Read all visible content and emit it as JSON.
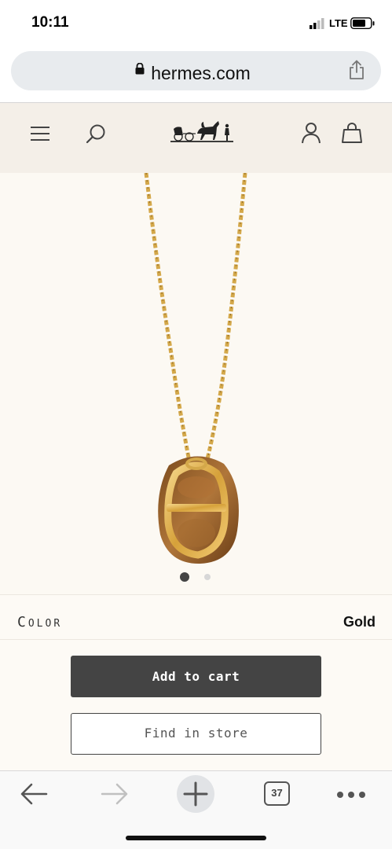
{
  "status_bar": {
    "time": "10:11",
    "network": "LTE"
  },
  "browser": {
    "url": "hermes.com"
  },
  "header": {
    "menu_icon": "hamburger-icon",
    "search_icon": "search-icon",
    "logo": "hermes-carriage-logo",
    "account_icon": "user-icon",
    "cart_icon": "shopping-bag-icon"
  },
  "product": {
    "image": "gold-chain-necklace-with-leather-pendant",
    "carousel": {
      "total": 2,
      "active": 1
    },
    "color_label": "Color",
    "color_value": "Gold",
    "add_to_cart_label": "Add to cart",
    "find_in_store_label": "Find in store"
  },
  "toolbar": {
    "tab_count": "37"
  },
  "colors": {
    "header_bg": "#f4efe8",
    "page_bg": "#fcf9f3",
    "button_dark": "#444444",
    "gold": "#d9a93c",
    "leather": "#a86a2b"
  }
}
